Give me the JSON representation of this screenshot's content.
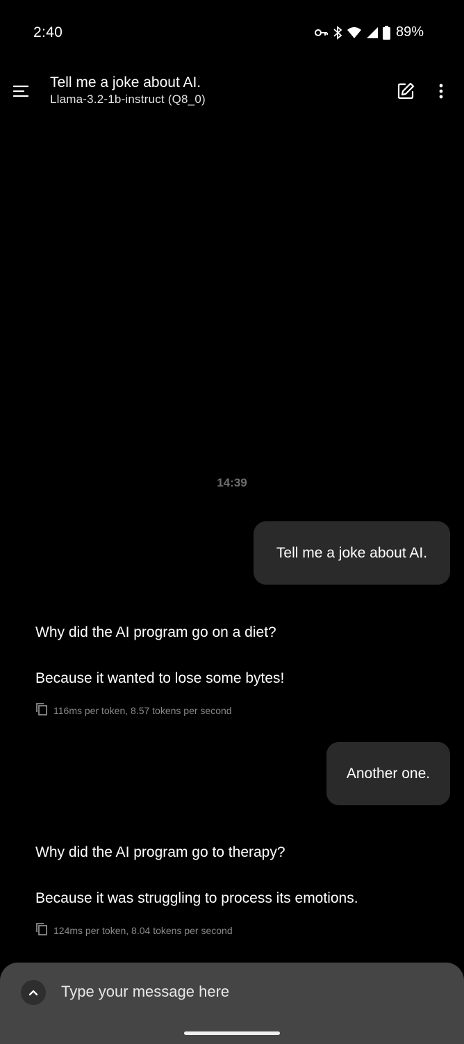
{
  "status_bar": {
    "time": "2:40",
    "battery": "89%",
    "icons": [
      "vpn-key-icon",
      "bluetooth-icon",
      "wifi-icon",
      "cell-signal-icon",
      "battery-icon"
    ]
  },
  "app_bar": {
    "title": "Tell me a joke about AI.",
    "model": "Llama-3.2-1b-instruct (Q8_0)",
    "icons": [
      "menu-icon",
      "edit-icon",
      "more-vert-icon"
    ]
  },
  "chat": {
    "timestamp": "14:39",
    "messages": [
      {
        "role": "user",
        "text": "Tell me a joke about AI."
      },
      {
        "role": "assistant",
        "paragraphs": [
          "Why did the AI program go on a diet?",
          "Because it wanted to lose some bytes!"
        ],
        "stats": "116ms per token, 8.57 tokens per second"
      },
      {
        "role": "user",
        "text": "Another one."
      },
      {
        "role": "assistant",
        "paragraphs": [
          "Why did the AI program go to therapy?",
          "Because it was struggling to process its emotions."
        ],
        "stats": "124ms per token, 8.04 tokens per second"
      }
    ]
  },
  "input": {
    "placeholder": "Type your message here"
  },
  "colors": {
    "background": "#000000",
    "user_bubble": "#2a2a2a",
    "input_panel": "#454545",
    "muted_text": "#8a8a8a"
  }
}
